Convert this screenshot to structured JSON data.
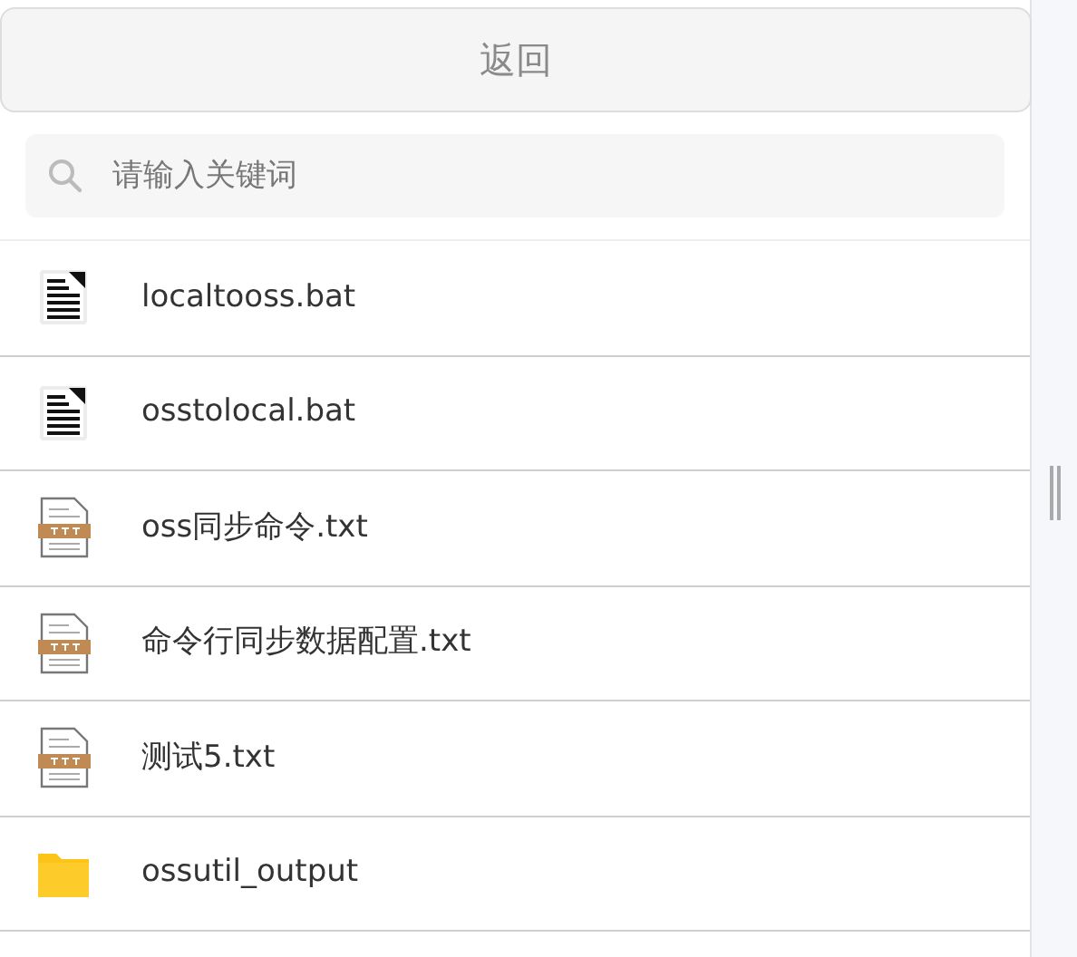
{
  "back_button": {
    "label": "返回"
  },
  "search": {
    "placeholder": "请输入关键词"
  },
  "files": [
    {
      "name": "localtooss.bat",
      "kind": "bat"
    },
    {
      "name": "osstolocal.bat",
      "kind": "bat"
    },
    {
      "name": "oss同步命令.txt",
      "kind": "txt"
    },
    {
      "name": "命令行同步数据配置.txt",
      "kind": "txt"
    },
    {
      "name": "测试5.txt",
      "kind": "txt"
    },
    {
      "name": "ossutil_output",
      "kind": "folder"
    }
  ]
}
